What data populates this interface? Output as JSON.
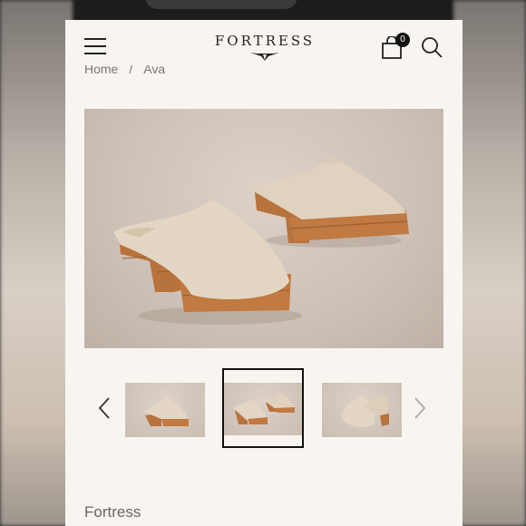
{
  "header": {
    "brand": "FORTRESS",
    "cart_count": "0"
  },
  "breadcrumb": {
    "home": "Home",
    "separator": "/",
    "current": "Ava"
  },
  "gallery": {
    "selected_index": 1,
    "thumbnail_count": 3
  },
  "product": {
    "vendor": "Fortress"
  },
  "colors": {
    "page_bg": "#f8f5f1",
    "shoe_leather": "#e0d2bf",
    "wood_heel": "#b8723c",
    "photo_bg": "#cfc2b8"
  }
}
